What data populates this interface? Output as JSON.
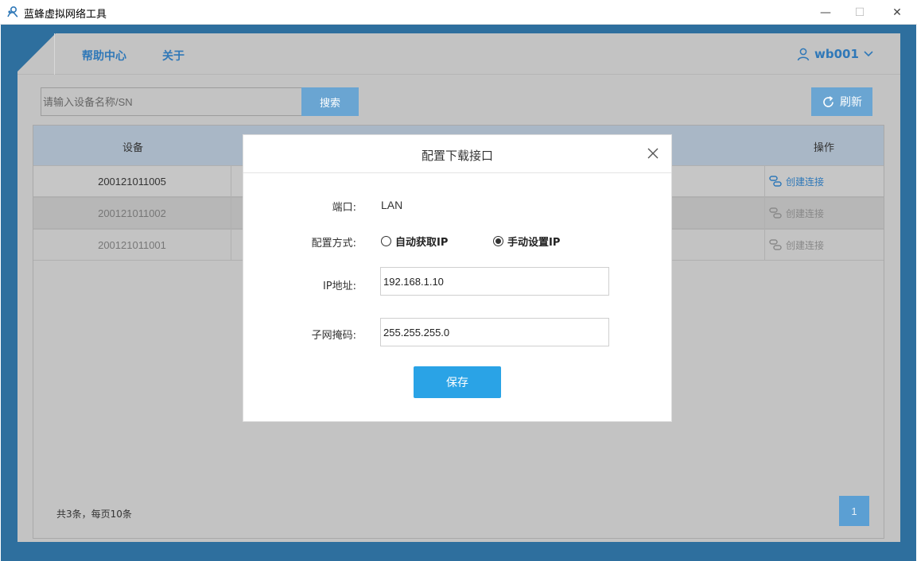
{
  "window": {
    "title": "蓝蜂虚拟网络工具",
    "minimize": "—",
    "maximize": "☐",
    "close": "✕"
  },
  "nav": {
    "items": [
      {
        "label": "帮助中心"
      },
      {
        "label": "关于"
      }
    ],
    "user": {
      "name": "wb001"
    }
  },
  "search": {
    "placeholder": "请输入设备名称/SN",
    "value": "",
    "button_label": "搜索"
  },
  "refresh_label": "刷新",
  "table": {
    "columns": [
      "设备",
      "操作"
    ],
    "rows": [
      {
        "sn": "200121011005",
        "action": "创建连接",
        "enabled": true
      },
      {
        "sn": "200121011002",
        "action": "创建连接",
        "enabled": false
      },
      {
        "sn": "200121011001",
        "action": "创建连接",
        "enabled": false
      }
    ]
  },
  "pagination": {
    "summary": "共3条，每页10条",
    "current_page": "1"
  },
  "modal": {
    "title": "配置下载接口",
    "port_label": "端口:",
    "port_value": "LAN",
    "mode_label": "配置方式:",
    "mode_options": [
      {
        "label": "自动获取IP",
        "checked": false
      },
      {
        "label": "手动设置IP",
        "checked": true
      }
    ],
    "ip_label": "IP地址:",
    "ip_value": "192.168.1.10",
    "mask_label": "子网掩码:",
    "mask_value": "255.255.255.0",
    "save_label": "保存"
  },
  "colors": {
    "chrome": "#2e6f9e",
    "accent": "#2aa3e6",
    "link": "#2f78b8",
    "overlay": "#c3c3c3"
  }
}
